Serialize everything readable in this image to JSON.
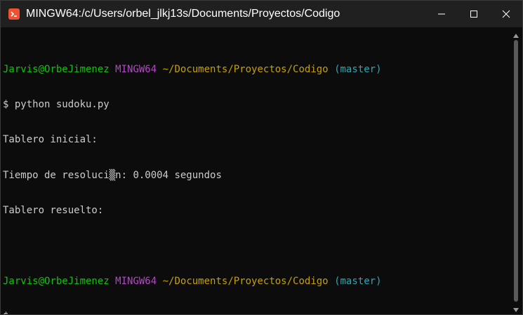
{
  "window": {
    "title": "MINGW64:/c/Users/orbel_jlkj13s/Documents/Proyectos/Codigo",
    "icons": {
      "app": "git-bash-icon",
      "minimize": "minimize-icon",
      "maximize": "maximize-icon",
      "close": "close-icon"
    }
  },
  "terminal": {
    "prompt1": {
      "user_host": "Jarvis@OrbeJimenez",
      "env": "MINGW64",
      "path": "~/Documents/Proyectos/Codigo",
      "branch": "(master)"
    },
    "command": "$ python sudoku.py",
    "output1": "Tablero inicial:",
    "output2_before": "Tiempo de resoluci",
    "output2_glyph": "▒",
    "output2_after": "n: 0.0004 segundos",
    "output3": "Tablero resuelto:",
    "prompt2": {
      "user_host": "Jarvis@OrbeJimenez",
      "env": "MINGW64",
      "path": "~/Documents/Proyectos/Codigo",
      "branch": "(master)"
    },
    "cursor_prompt": "$"
  },
  "colors": {
    "user_host": "#13c20e",
    "env": "#b148c6",
    "path": "#c4a000",
    "branch": "#2aa7b6"
  }
}
